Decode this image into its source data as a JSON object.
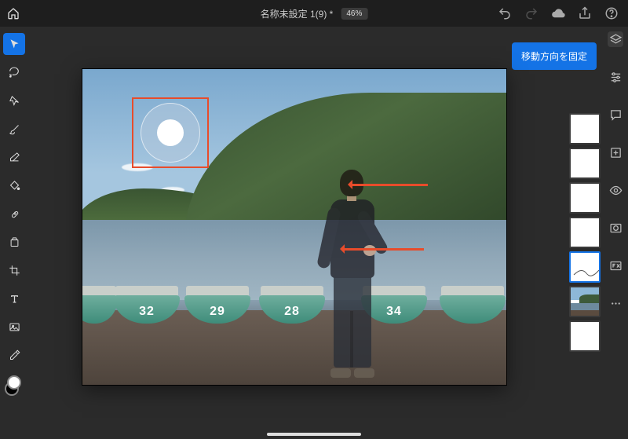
{
  "header": {
    "document_title": "名称未設定 1(9) *",
    "zoom": "46%"
  },
  "action_button": {
    "label": "移動方向を固定"
  },
  "left_tools": [
    {
      "name": "move",
      "active": true
    },
    {
      "name": "lasso",
      "active": false
    },
    {
      "name": "wand",
      "active": false
    },
    {
      "name": "brush",
      "active": false
    },
    {
      "name": "eraser",
      "active": false
    },
    {
      "name": "fill",
      "active": false
    },
    {
      "name": "heal",
      "active": false
    },
    {
      "name": "clone",
      "active": false
    },
    {
      "name": "crop",
      "active": false
    },
    {
      "name": "type",
      "active": false
    },
    {
      "name": "place",
      "active": false
    },
    {
      "name": "eyedropper",
      "active": false
    }
  ],
  "right_panel_icons": [
    "layers",
    "properties",
    "comments",
    "add",
    "visibility",
    "mask",
    "fx",
    "more"
  ],
  "layers": [
    {
      "id": 0,
      "kind": "blank",
      "selected": false
    },
    {
      "id": 1,
      "kind": "blank",
      "selected": false
    },
    {
      "id": 2,
      "kind": "blank",
      "selected": false
    },
    {
      "id": 3,
      "kind": "blank",
      "selected": false
    },
    {
      "id": 4,
      "kind": "content",
      "selected": true
    },
    {
      "id": 5,
      "kind": "image",
      "selected": false
    },
    {
      "id": 6,
      "kind": "blank",
      "selected": false
    }
  ],
  "canvas": {
    "boats": [
      {
        "slot": 1,
        "number": ""
      },
      {
        "slot": 2,
        "number": "32"
      },
      {
        "slot": 3,
        "number": "29"
      },
      {
        "slot": 4,
        "number": "28"
      },
      {
        "slot": 5,
        "number": "34"
      },
      {
        "slot": 6,
        "number": ""
      }
    ],
    "annotation": {
      "selection_ring": true,
      "arrows": 2
    }
  }
}
